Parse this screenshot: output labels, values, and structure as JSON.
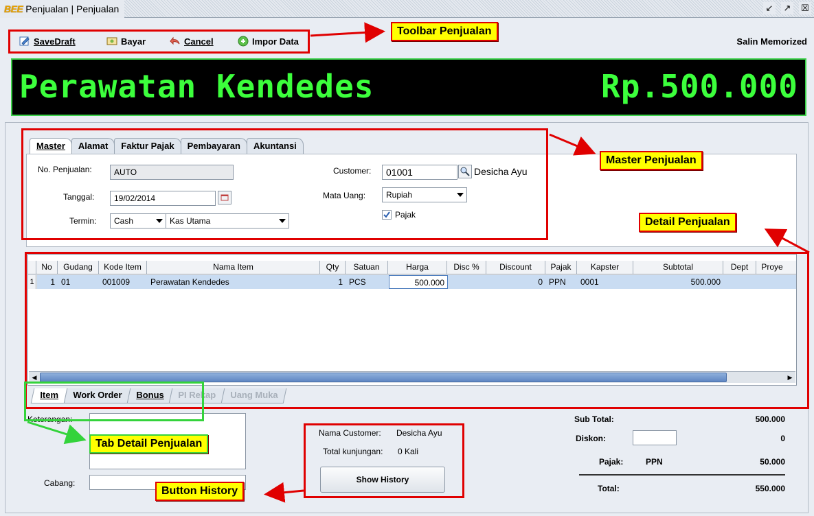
{
  "window": {
    "logo": "BEE",
    "title": "Penjualan | Penjualan",
    "controls": [
      "restore-icon",
      "maximize-icon",
      "close-icon"
    ]
  },
  "toolbar": {
    "items": [
      {
        "label": "SaveDraft",
        "icon": "save-draft-icon"
      },
      {
        "label": "Bayar",
        "icon": "pay-icon"
      },
      {
        "label": "Cancel",
        "icon": "cancel-icon"
      },
      {
        "label": "Impor Data",
        "icon": "import-icon"
      }
    ],
    "right_label": "Salin Memorized"
  },
  "banner": {
    "item_name": "Perawatan Kendedes",
    "amount": "Rp.500.000"
  },
  "master_tabs": [
    "Master",
    "Alamat",
    "Faktur Pajak",
    "Pembayaran",
    "Akuntansi"
  ],
  "master": {
    "no_penjualan_label": "No. Penjualan:",
    "no_penjualan": "AUTO",
    "tanggal_label": "Tanggal:",
    "tanggal": "19/02/2014",
    "termin_label": "Termin:",
    "termin": "Cash",
    "kas": "Kas Utama",
    "customer_label": "Customer:",
    "customer_code": "01001",
    "customer_name": "Desicha Ayu",
    "mata_uang_label": "Mata Uang:",
    "mata_uang": "Rupiah",
    "pajak_label": "Pajak",
    "pajak_checked": true
  },
  "grid": {
    "columns": [
      "No",
      "Gudang",
      "Kode Item",
      "Nama Item",
      "Qty",
      "Satuan",
      "Harga",
      "Disc %",
      "Discount",
      "Pajak",
      "Kapster",
      "Subtotal",
      "Dept",
      "Proye"
    ],
    "rows": [
      {
        "row_num": "1",
        "no": "1",
        "gudang": "01",
        "kode": "001009",
        "nama": "Perawatan Kendedes",
        "qty": "1",
        "satuan": "PCS",
        "harga": "500.000",
        "disc_pct": "",
        "discount": "0",
        "pajak": "PPN",
        "kapster": "0001",
        "subtotal": "500.000",
        "dept": "",
        "proyek": ""
      }
    ]
  },
  "detail_tabs": [
    {
      "label": "Item",
      "enabled": true
    },
    {
      "label": "Work Order",
      "enabled": true
    },
    {
      "label": "Bonus",
      "enabled": true
    },
    {
      "label": "PI Rekap",
      "enabled": false
    },
    {
      "label": "Uang Muka",
      "enabled": false
    }
  ],
  "bottom": {
    "keterangan_label": "Keterangan:",
    "cabang_label": "Cabang:",
    "nama_customer_label": "Nama Customer:",
    "nama_customer": "Desicha Ayu",
    "total_kunjungan_label": "Total kunjungan:",
    "total_kunjungan": "0 Kali",
    "show_history": "Show History"
  },
  "totals": {
    "sub_total_label": "Sub Total:",
    "sub_total": "500.000",
    "diskon_label": "Diskon:",
    "diskon": "0",
    "pajak_label": "Pajak:",
    "pajak_type": "PPN",
    "pajak": "50.000",
    "total_label": "Total:",
    "total": "550.000"
  },
  "annotations": {
    "toolbar": "Toolbar Penjualan",
    "master": "Master Penjualan",
    "detail": "Detail Penjualan",
    "tab_detail": "Tab Detail Penjualan",
    "history": "Button History"
  },
  "colors": {
    "banner_text": "#3cff3c",
    "callout_bg": "#ffff00",
    "callout_border": "#e00000",
    "selected_row": "#c9dcf2"
  }
}
